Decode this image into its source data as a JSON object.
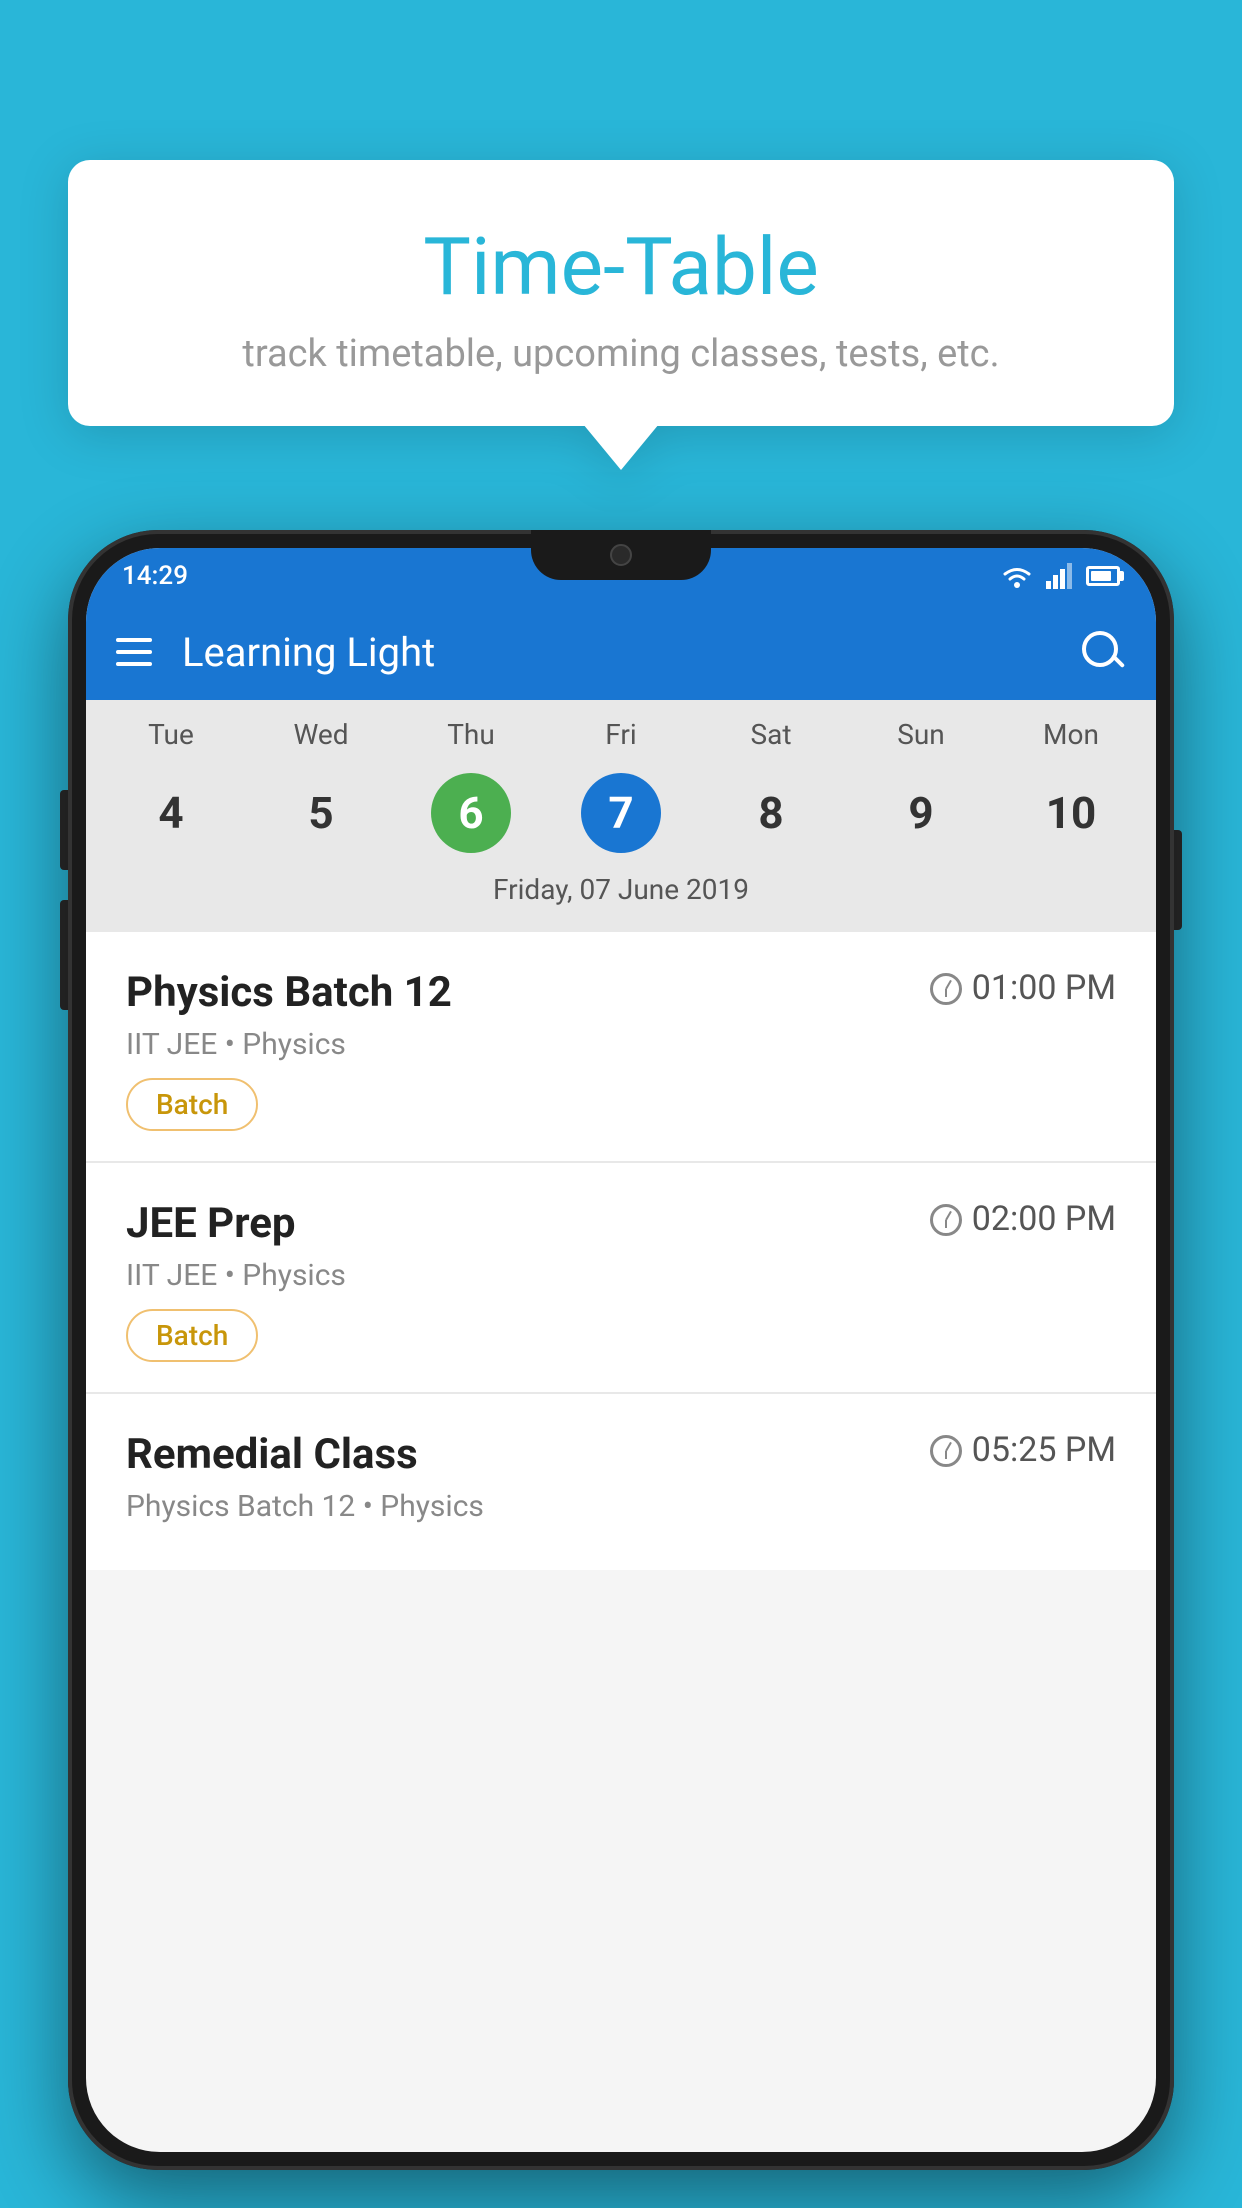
{
  "background_color": "#29B6D8",
  "tooltip": {
    "title": "Time-Table",
    "subtitle": "track timetable, upcoming classes, tests, etc."
  },
  "phone": {
    "status_bar": {
      "time": "14:29"
    },
    "header": {
      "app_title": "Learning Light",
      "hamburger_label": "menu",
      "search_label": "search"
    },
    "calendar": {
      "weekdays": [
        "Tue",
        "Wed",
        "Thu",
        "Fri",
        "Sat",
        "Sun",
        "Mon"
      ],
      "dates": [
        "4",
        "5",
        "6",
        "7",
        "8",
        "9",
        "10"
      ],
      "today_index": 2,
      "selected_index": 3,
      "selected_date_label": "Friday, 07 June 2019"
    },
    "schedule_items": [
      {
        "title": "Physics Batch 12",
        "time": "01:00 PM",
        "subtitle": "IIT JEE • Physics",
        "badge": "Batch"
      },
      {
        "title": "JEE Prep",
        "time": "02:00 PM",
        "subtitle": "IIT JEE • Physics",
        "badge": "Batch"
      },
      {
        "title": "Remedial Class",
        "time": "05:25 PM",
        "subtitle": "Physics Batch 12 • Physics",
        "badge": ""
      }
    ]
  }
}
